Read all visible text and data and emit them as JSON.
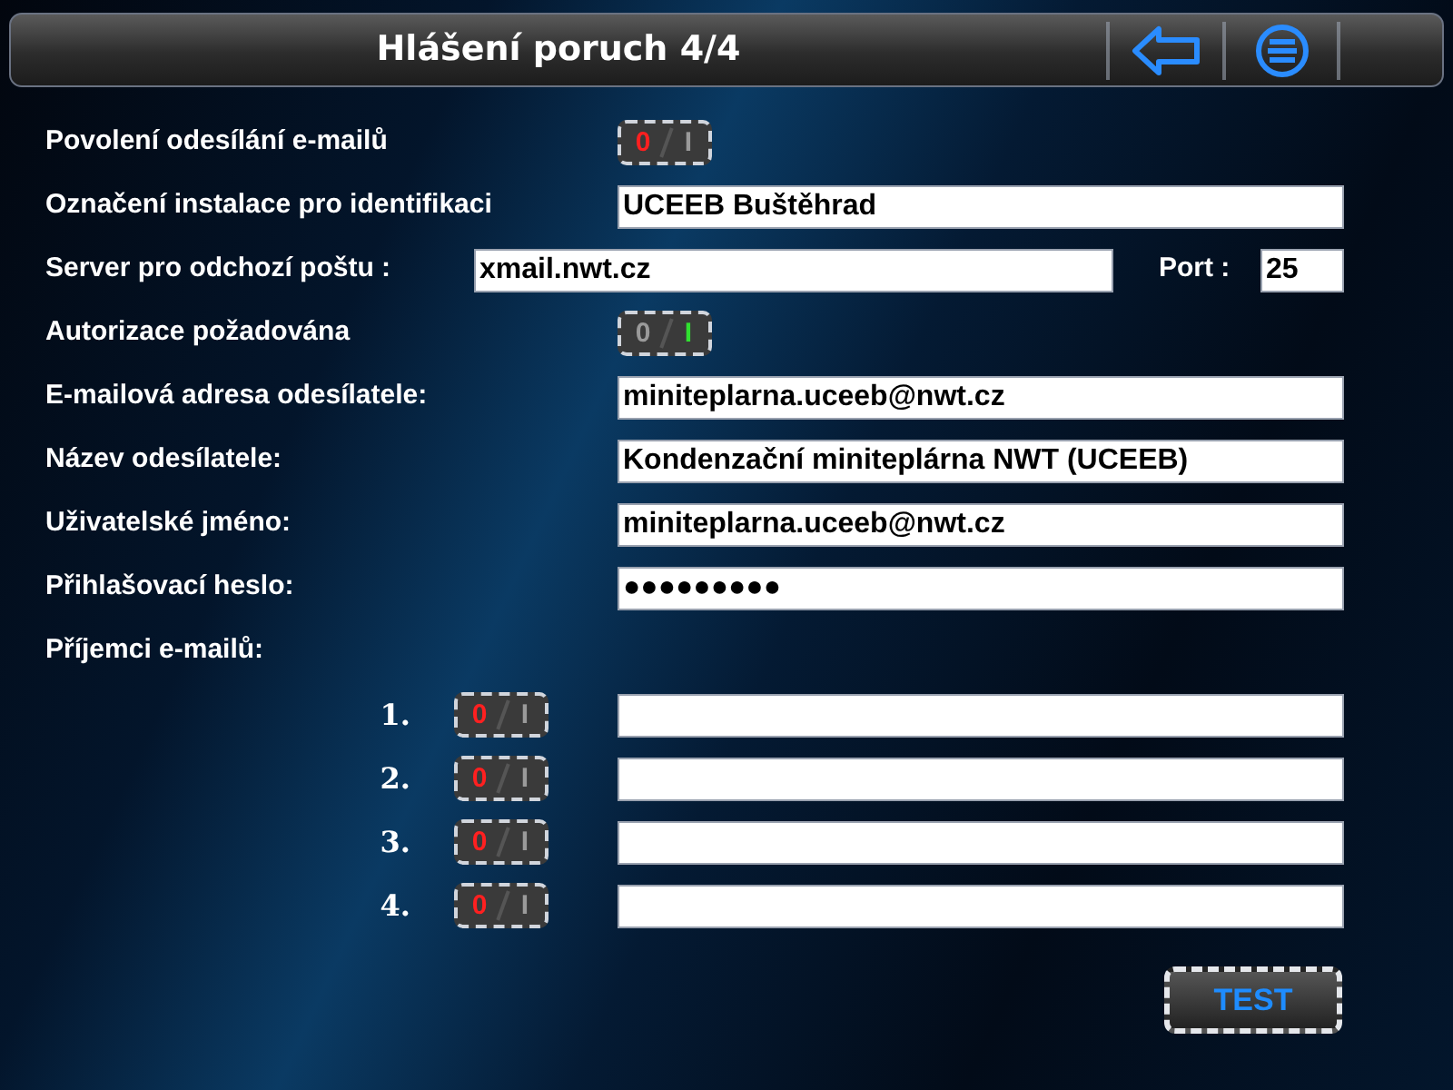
{
  "header": {
    "title": "Hlášení poruch 4/4"
  },
  "settings": [
    {
      "kind": "toggle",
      "label": "Povolení odesílání e-mailů",
      "on": false,
      "off_text": "0",
      "on_text": "I"
    },
    {
      "kind": "field",
      "label": "Označení instalace pro identifikaci",
      "value": "UCEEB Buštěhrad"
    },
    {
      "kind": "server",
      "label": "Server pro odchozí poštu :",
      "value": "xmail.nwt.cz",
      "port_label": "Port :",
      "port_value": "25"
    },
    {
      "kind": "toggle",
      "label": "Autorizace požadována",
      "on": true,
      "off_text": "0",
      "on_text": "I"
    },
    {
      "kind": "field",
      "label": "E-mailová adresa odesílatele:",
      "value": "miniteplarna.uceeb@nwt.cz"
    },
    {
      "kind": "field",
      "label": "Název odesílatele:",
      "value": "Kondenzační miniteplárna NWT (UCEEB)"
    },
    {
      "kind": "field",
      "label": "Uživatelské jméno:",
      "value": "miniteplarna.uceeb@nwt.cz"
    },
    {
      "kind": "field",
      "label": "Přihlašovací heslo:",
      "value": "●●●●●●●●●"
    },
    {
      "kind": "heading",
      "label": "Příjemci e-mailů:"
    }
  ],
  "recipients": [
    {
      "number": "1.",
      "on": false,
      "off_text": "0",
      "on_text": "I"
    },
    {
      "number": "2.",
      "on": false,
      "off_text": "0",
      "on_text": "I"
    },
    {
      "number": "3.",
      "on": false,
      "off_text": "0",
      "on_text": "I"
    },
    {
      "number": "4.",
      "on": false,
      "off_text": "0",
      "on_text": "I"
    }
  ],
  "test_button": "TEST"
}
